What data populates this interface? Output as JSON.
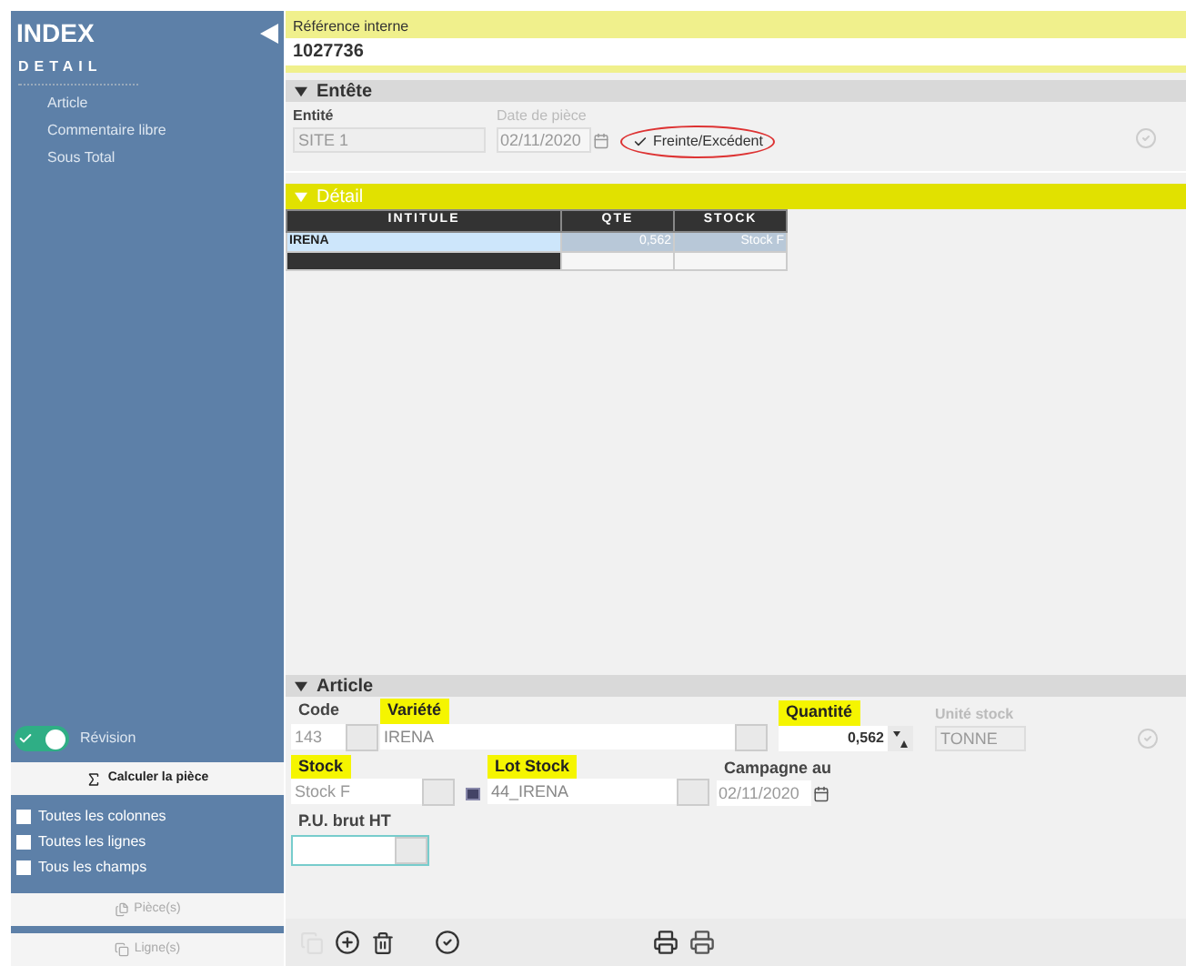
{
  "sidebar": {
    "title": "INDEX",
    "section": "DETAIL",
    "items": [
      {
        "label": "Article",
        "selected": false
      },
      {
        "label": "Commentaire libre",
        "selected": false
      },
      {
        "label": "Sous Total",
        "selected": false
      }
    ],
    "revision": {
      "label": "Révision",
      "on": true
    },
    "calculate_button": "Calculer la pièce",
    "options": [
      {
        "label": "Toutes les colonnes",
        "checked": false
      },
      {
        "label": "Toutes les lignes",
        "checked": false
      },
      {
        "label": "Tous les champs",
        "checked": false
      }
    ],
    "buttons": [
      "Pièce(s)",
      "Ligne(s)"
    ]
  },
  "reference": {
    "label": "Référence interne",
    "value": "1027736"
  },
  "entete": {
    "title": "Entête",
    "expanded": true,
    "entity": {
      "label": "Entité",
      "value": "SITE 1"
    },
    "date": {
      "label": "Date de pièce",
      "value": "02/11/2020"
    },
    "shrinkage": {
      "label": "Freinte/Excédent",
      "checked": true
    }
  },
  "detail": {
    "title": "Détail",
    "expanded": true,
    "columns": [
      "INTITULE",
      "QTE",
      "STOCK"
    ],
    "rows": [
      {
        "cells": [
          "IRENA",
          "0,562",
          "Stock F"
        ],
        "selected": true
      }
    ]
  },
  "article": {
    "title": "Article",
    "expanded": true,
    "code": {
      "label": "Code",
      "value": "143",
      "highlighted": false
    },
    "variety": {
      "label": "Variété",
      "value": "IRENA",
      "highlighted": true
    },
    "quantity": {
      "label": "Quantité",
      "value": "0,562",
      "highlighted": true
    },
    "unit": {
      "label": "Unité stock",
      "value": "TONNE",
      "highlighted": false
    },
    "stock": {
      "label": "Stock",
      "value": "Stock F",
      "highlighted": true
    },
    "lot": {
      "label": "Lot Stock",
      "value": "44_IRENA",
      "highlighted": true
    },
    "campaign": {
      "label": "Campagne au",
      "value": "02/11/2020",
      "highlighted": false
    },
    "price": {
      "label": "P.U. brut HT",
      "highlighted": false
    }
  }
}
